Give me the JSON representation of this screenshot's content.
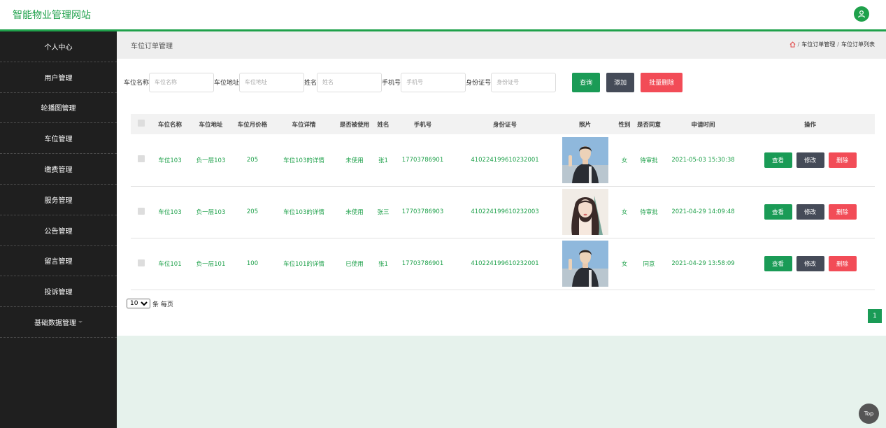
{
  "app_title": "智能物业管理网站",
  "sidebar": {
    "items": [
      {
        "label": "个人中心"
      },
      {
        "label": "用户管理"
      },
      {
        "label": "轮播图管理"
      },
      {
        "label": "车位管理"
      },
      {
        "label": "缴费管理"
      },
      {
        "label": "服务管理"
      },
      {
        "label": "公告管理"
      },
      {
        "label": "留言管理"
      },
      {
        "label": "投诉管理"
      },
      {
        "label": "基础数据管理"
      }
    ]
  },
  "header": {
    "title": "车位订单管理",
    "breadcrumb": [
      "车位订单管理",
      "车位订单列表"
    ],
    "breadcrumb_sep": "/"
  },
  "search": {
    "fields": [
      {
        "label": "车位名称",
        "placeholder": "车位名称"
      },
      {
        "label": "车位地址",
        "placeholder": "车位地址"
      },
      {
        "label": "姓名",
        "placeholder": "姓名"
      },
      {
        "label": "手机号",
        "placeholder": "手机号"
      },
      {
        "label": "身份证号",
        "placeholder": "身份证号"
      }
    ],
    "query_label": "查询",
    "add_label": "添加",
    "batch_delete_label": "批量删除"
  },
  "table": {
    "columns": [
      "车位名称",
      "车位地址",
      "车位月价格",
      "车位详情",
      "是否被使用",
      "姓名",
      "手机号",
      "身份证号",
      "照片",
      "性别",
      "是否同意",
      "申请时间",
      "操作"
    ],
    "rows": [
      {
        "name": "车位103",
        "address": "负一层103",
        "price": "205",
        "detail": "车位103的详情",
        "used": "未使用",
        "person": "张1",
        "phone": "17703786901",
        "id_card": "410224199610232001",
        "photo": "male",
        "gender": "女",
        "status": "待审批",
        "time": "2021-05-03 15:30:38"
      },
      {
        "name": "车位103",
        "address": "负一层103",
        "price": "205",
        "detail": "车位103的详情",
        "used": "未使用",
        "person": "张三",
        "phone": "17703786903",
        "id_card": "410224199610232003",
        "photo": "female",
        "gender": "女",
        "status": "待审批",
        "time": "2021-04-29 14:09:48"
      },
      {
        "name": "车位101",
        "address": "负一层101",
        "price": "100",
        "detail": "车位101的详情",
        "used": "已使用",
        "person": "张1",
        "phone": "17703786901",
        "id_card": "410224199610232001",
        "photo": "male",
        "gender": "女",
        "status": "同意",
        "time": "2021-04-29 13:58:09"
      }
    ],
    "actions": {
      "view": "查看",
      "edit": "修改",
      "delete": "删除"
    }
  },
  "pagination": {
    "page_size": "10",
    "page_size_suffix": "条 每页",
    "current_page": "1"
  },
  "back_to_top": "Top",
  "colors": {
    "brand": "#1fa14b",
    "sidebar": "#1f1f1f",
    "danger": "#f24c57",
    "dark": "#454b58"
  }
}
